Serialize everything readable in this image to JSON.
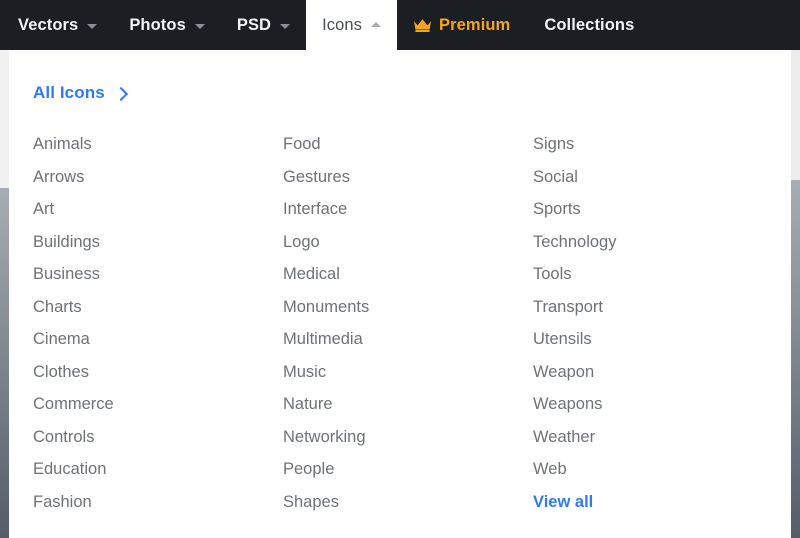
{
  "navbar": {
    "background_color": "#1b1f24",
    "items": [
      {
        "label": "Vectors",
        "has_caret": true,
        "active": false,
        "kind": "dropdown"
      },
      {
        "label": "Photos",
        "has_caret": true,
        "active": false,
        "kind": "dropdown"
      },
      {
        "label": "PSD",
        "has_caret": true,
        "active": false,
        "kind": "dropdown"
      },
      {
        "label": "Icons",
        "has_caret": true,
        "active": true,
        "kind": "dropdown-open"
      },
      {
        "label": "Premium",
        "has_caret": false,
        "active": false,
        "kind": "premium",
        "icon": "crown-icon",
        "color": "#f4a51d"
      },
      {
        "label": "Collections",
        "has_caret": false,
        "active": false,
        "kind": "link"
      }
    ]
  },
  "panel": {
    "header": {
      "label": "All Icons",
      "icon": "chevron-right-icon",
      "color": "#2f7bf0"
    },
    "columns": [
      {
        "items": [
          "Animals",
          "Arrows",
          "Art",
          "Buildings",
          "Business",
          "Charts",
          "Cinema",
          "Clothes",
          "Commerce",
          "Controls",
          "Education",
          "Fashion"
        ]
      },
      {
        "items": [
          "Food",
          "Gestures",
          "Interface",
          "Logo",
          "Medical",
          "Monuments",
          "Multimedia",
          "Music",
          "Nature",
          "Networking",
          "People",
          "Shapes"
        ]
      },
      {
        "items": [
          "Signs",
          "Social",
          "Sports",
          "Technology",
          "Tools",
          "Transport",
          "Utensils",
          "Weapon",
          "Weapons",
          "Weather",
          "Web"
        ],
        "view_all_label": "View all"
      }
    ]
  },
  "colors": {
    "nav_background": "#1b1f24",
    "nav_text": "#f2f3f4",
    "active_tab_background": "#ffffff",
    "active_tab_text": "#4a4f55",
    "premium_accent": "#f4a51d",
    "link_blue": "#2f7bf0",
    "category_text": "#6e7277",
    "panel_background": "#ffffff"
  }
}
